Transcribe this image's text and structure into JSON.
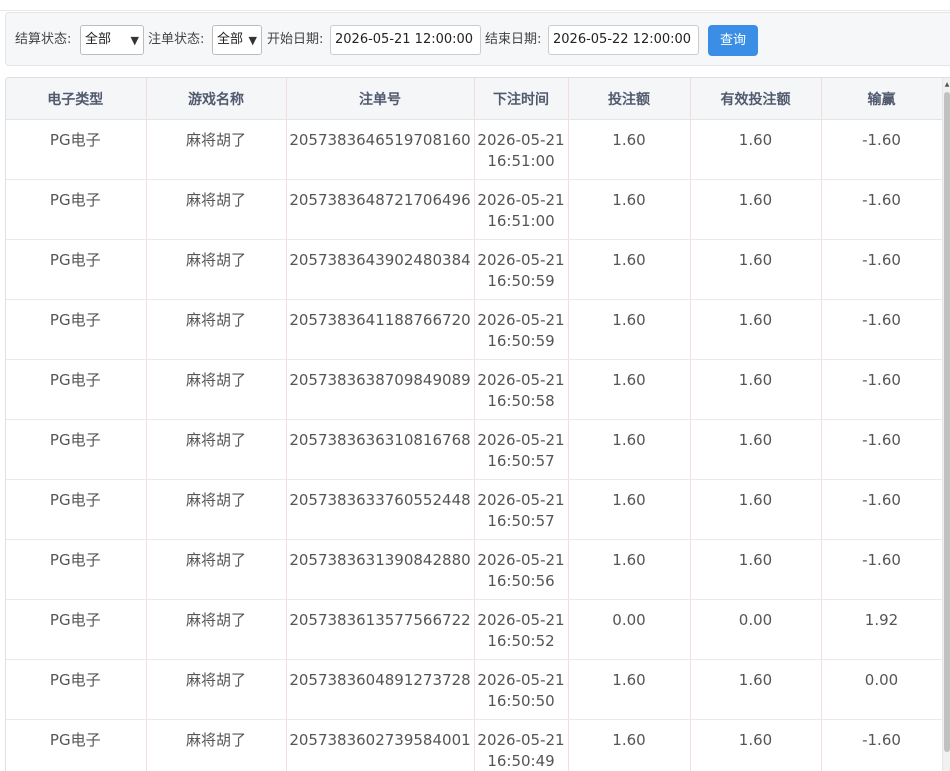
{
  "filters": {
    "settle_status_label": "结算状态:",
    "settle_status_value": "全部",
    "order_status_label": "注单状态:",
    "order_status_value": "全部",
    "start_date_label": "开始日期:",
    "start_date_value": "2026-05-21 12:00:00",
    "end_date_label": "结束日期:",
    "end_date_value": "2026-05-22 12:00:00",
    "query_label": "查询"
  },
  "table": {
    "columns": [
      "电子类型",
      "游戏名称",
      "注单号",
      "下注时间",
      "投注额",
      "有效投注额",
      "输赢"
    ],
    "rows": [
      {
        "type": "PG电子",
        "game": "麻将胡了",
        "order_no": "2057383646519708160",
        "date": "2026-05-21",
        "time": "16:51:00",
        "bet": "1.60",
        "valid_bet": "1.60",
        "win_loss": "-1.60"
      },
      {
        "type": "PG电子",
        "game": "麻将胡了",
        "order_no": "2057383648721706496",
        "date": "2026-05-21",
        "time": "16:51:00",
        "bet": "1.60",
        "valid_bet": "1.60",
        "win_loss": "-1.60"
      },
      {
        "type": "PG电子",
        "game": "麻将胡了",
        "order_no": "2057383643902480384",
        "date": "2026-05-21",
        "time": "16:50:59",
        "bet": "1.60",
        "valid_bet": "1.60",
        "win_loss": "-1.60"
      },
      {
        "type": "PG电子",
        "game": "麻将胡了",
        "order_no": "2057383641188766720",
        "date": "2026-05-21",
        "time": "16:50:59",
        "bet": "1.60",
        "valid_bet": "1.60",
        "win_loss": "-1.60"
      },
      {
        "type": "PG电子",
        "game": "麻将胡了",
        "order_no": "2057383638709849089",
        "date": "2026-05-21",
        "time": "16:50:58",
        "bet": "1.60",
        "valid_bet": "1.60",
        "win_loss": "-1.60"
      },
      {
        "type": "PG电子",
        "game": "麻将胡了",
        "order_no": "2057383636310816768",
        "date": "2026-05-21",
        "time": "16:50:57",
        "bet": "1.60",
        "valid_bet": "1.60",
        "win_loss": "-1.60"
      },
      {
        "type": "PG电子",
        "game": "麻将胡了",
        "order_no": "2057383633760552448",
        "date": "2026-05-21",
        "time": "16:50:57",
        "bet": "1.60",
        "valid_bet": "1.60",
        "win_loss": "-1.60"
      },
      {
        "type": "PG电子",
        "game": "麻将胡了",
        "order_no": "2057383631390842880",
        "date": "2026-05-21",
        "time": "16:50:56",
        "bet": "1.60",
        "valid_bet": "1.60",
        "win_loss": "-1.60"
      },
      {
        "type": "PG电子",
        "game": "麻将胡了",
        "order_no": "2057383613577566722",
        "date": "2026-05-21",
        "time": "16:50:52",
        "bet": "0.00",
        "valid_bet": "0.00",
        "win_loss": "1.92"
      },
      {
        "type": "PG电子",
        "game": "麻将胡了",
        "order_no": "2057383604891273728",
        "date": "2026-05-21",
        "time": "16:50:50",
        "bet": "1.60",
        "valid_bet": "1.60",
        "win_loss": "0.00"
      },
      {
        "type": "PG电子",
        "game": "麻将胡了",
        "order_no": "2057383602739584001",
        "date": "2026-05-21",
        "time": "16:50:49",
        "bet": "1.60",
        "valid_bet": "1.60",
        "win_loss": "-1.60"
      }
    ]
  }
}
